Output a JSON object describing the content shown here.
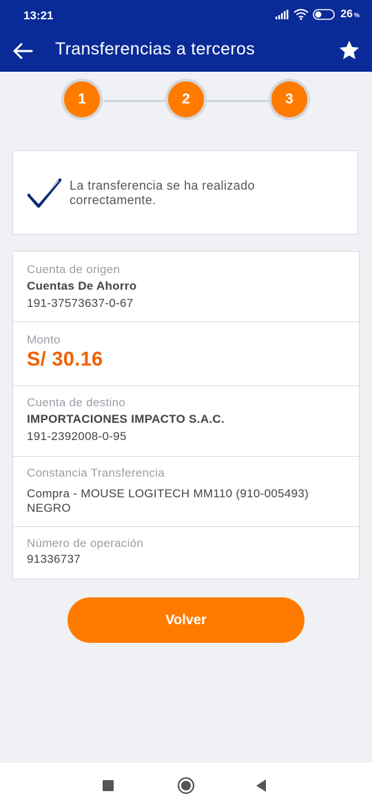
{
  "status_bar": {
    "time": "13:21",
    "battery_level": "26",
    "battery_suffix": "%",
    "icons": [
      "signal-icon",
      "wifi-icon",
      "battery-icon"
    ]
  },
  "toolbar": {
    "title": "Transferencias a terceros",
    "back_icon": "arrow-left-icon",
    "favorite_icon": "star-icon"
  },
  "stepper": {
    "steps": [
      "1",
      "2",
      "3"
    ],
    "active_color": "#ff7b00"
  },
  "success": {
    "message": "La transferencia se ha realizado correctamente.",
    "icon": "checkmark-icon"
  },
  "details": {
    "origin": {
      "label": "Cuenta de origen",
      "account_type": "Cuentas De Ahorro",
      "account_number": "191-37573637-0-67"
    },
    "amount": {
      "label": "Monto",
      "value": "S/ 30.16"
    },
    "destination": {
      "label": "Cuenta de destino",
      "name": "IMPORTACIONES IMPACTO S.A.C.",
      "account_number": "191-2392008-0-95"
    },
    "receipt": {
      "label": "Constancia Transferencia",
      "description": "Compra - MOUSE LOGITECH MM110 (910-005493) NEGRO"
    },
    "operation": {
      "label": "Número de operación",
      "number": "91336737"
    }
  },
  "actions": {
    "back_button": "Volver"
  },
  "colors": {
    "header": "#0a2a97",
    "accent": "#ff7b00",
    "amount": "#f06000"
  }
}
